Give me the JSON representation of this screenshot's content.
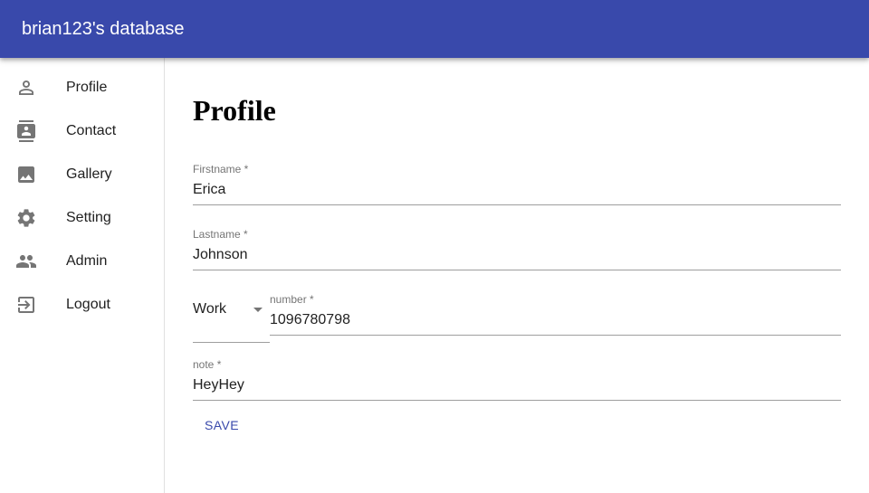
{
  "appbar": {
    "title": "brian123's database",
    "color": "#3949ab"
  },
  "sidebar": {
    "items": [
      {
        "label": "Profile",
        "icon": "person-outline-icon"
      },
      {
        "label": "Contact",
        "icon": "contacts-icon"
      },
      {
        "label": "Gallery",
        "icon": "image-icon"
      },
      {
        "label": "Setting",
        "icon": "settings-icon"
      },
      {
        "label": "Admin",
        "icon": "group-icon"
      },
      {
        "label": "Logout",
        "icon": "exit-to-app-icon"
      }
    ]
  },
  "main": {
    "title": "Profile",
    "form": {
      "firstname": {
        "label": "Firstname *",
        "value": "Erica"
      },
      "lastname": {
        "label": "Lastname *",
        "value": "Johnson"
      },
      "phone_type": {
        "value": "Work"
      },
      "number": {
        "label": "number *",
        "value": "1096780798"
      },
      "note": {
        "label": "note *",
        "value": "HeyHey"
      },
      "save_label": "SAVE"
    }
  }
}
